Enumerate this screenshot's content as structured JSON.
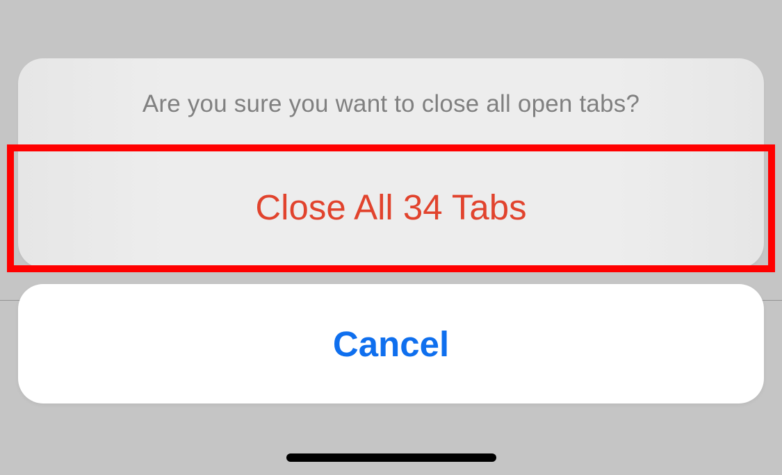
{
  "dialog": {
    "prompt": "Are you sure you want to close all open tabs?",
    "destructive_action_label": "Close All 34 Tabs",
    "cancel_label": "Cancel"
  }
}
